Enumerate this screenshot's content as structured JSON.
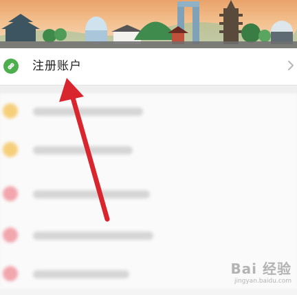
{
  "header": {
    "banner_name": "city-skyline-banner"
  },
  "menu": {
    "register_account": {
      "label": "注册账户",
      "icon": "link-icon",
      "chevron": "chevron-right-icon"
    }
  },
  "list": {
    "blurred_items": [
      {
        "icon_color": "#f6cf7a"
      },
      {
        "icon_color": "#f6cf7a"
      },
      {
        "icon_color": "#f2a6ad"
      },
      {
        "icon_color": "#f2a6ad"
      },
      {
        "icon_color": "#f2a6ad"
      }
    ]
  },
  "annotation": {
    "arrow_color": "#d9262e"
  },
  "watermark": {
    "line1": "Bai 经验",
    "line2": "jingyan.baidu.com"
  },
  "colors": {
    "accent_green": "#4cae4c",
    "background": "#f4f4f4"
  }
}
